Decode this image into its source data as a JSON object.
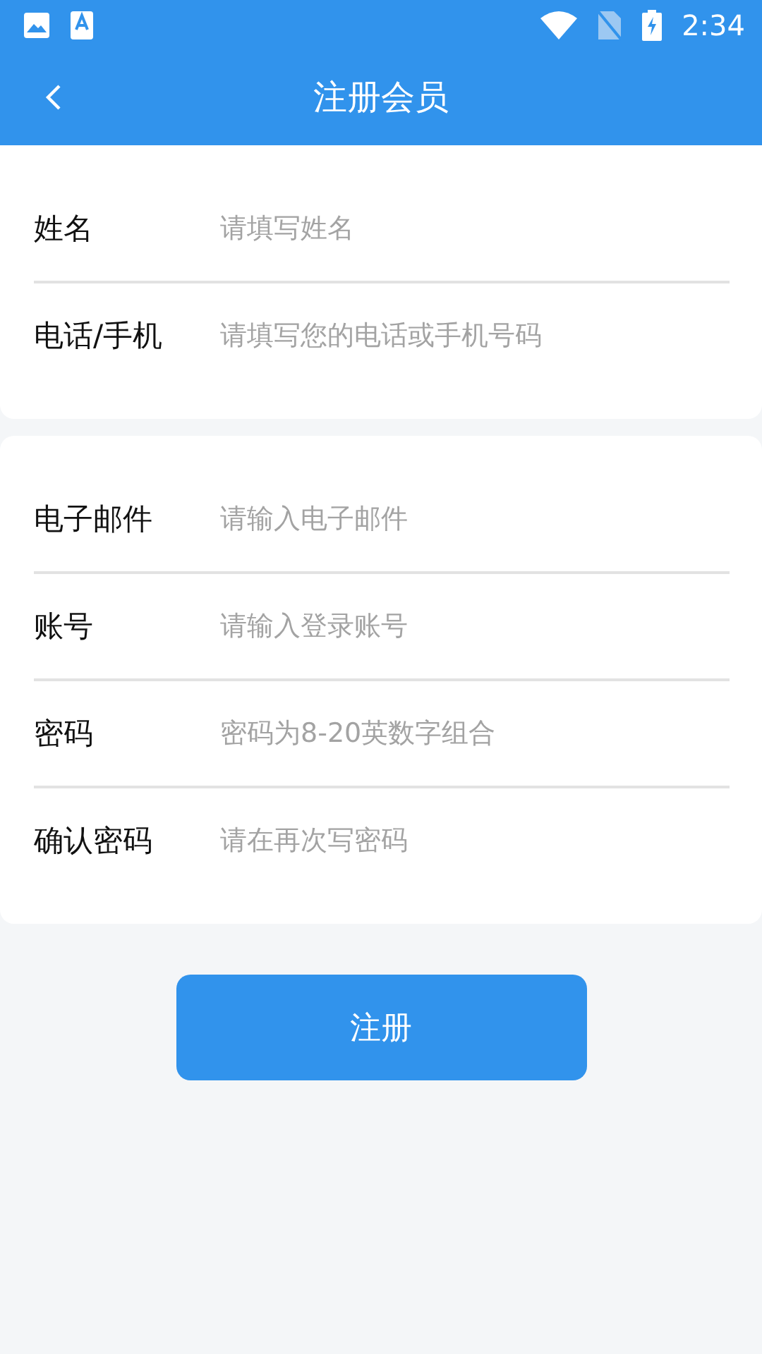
{
  "status_bar": {
    "time": "2:34"
  },
  "header": {
    "title": "注册会员"
  },
  "sections": [
    {
      "fields": [
        {
          "label": "姓名",
          "placeholder": "请填写姓名"
        },
        {
          "label": "电话/手机",
          "placeholder": "请填写您的电话或手机号码"
        }
      ]
    },
    {
      "fields": [
        {
          "label": "电子邮件",
          "placeholder": "请输入电子邮件"
        },
        {
          "label": "账号",
          "placeholder": "请输入登录账号"
        },
        {
          "label": "密码",
          "placeholder": "密码为8-20英数字组合"
        },
        {
          "label": "确认密码",
          "placeholder": "请在再次写密码"
        }
      ]
    }
  ],
  "submit_button": "注册"
}
